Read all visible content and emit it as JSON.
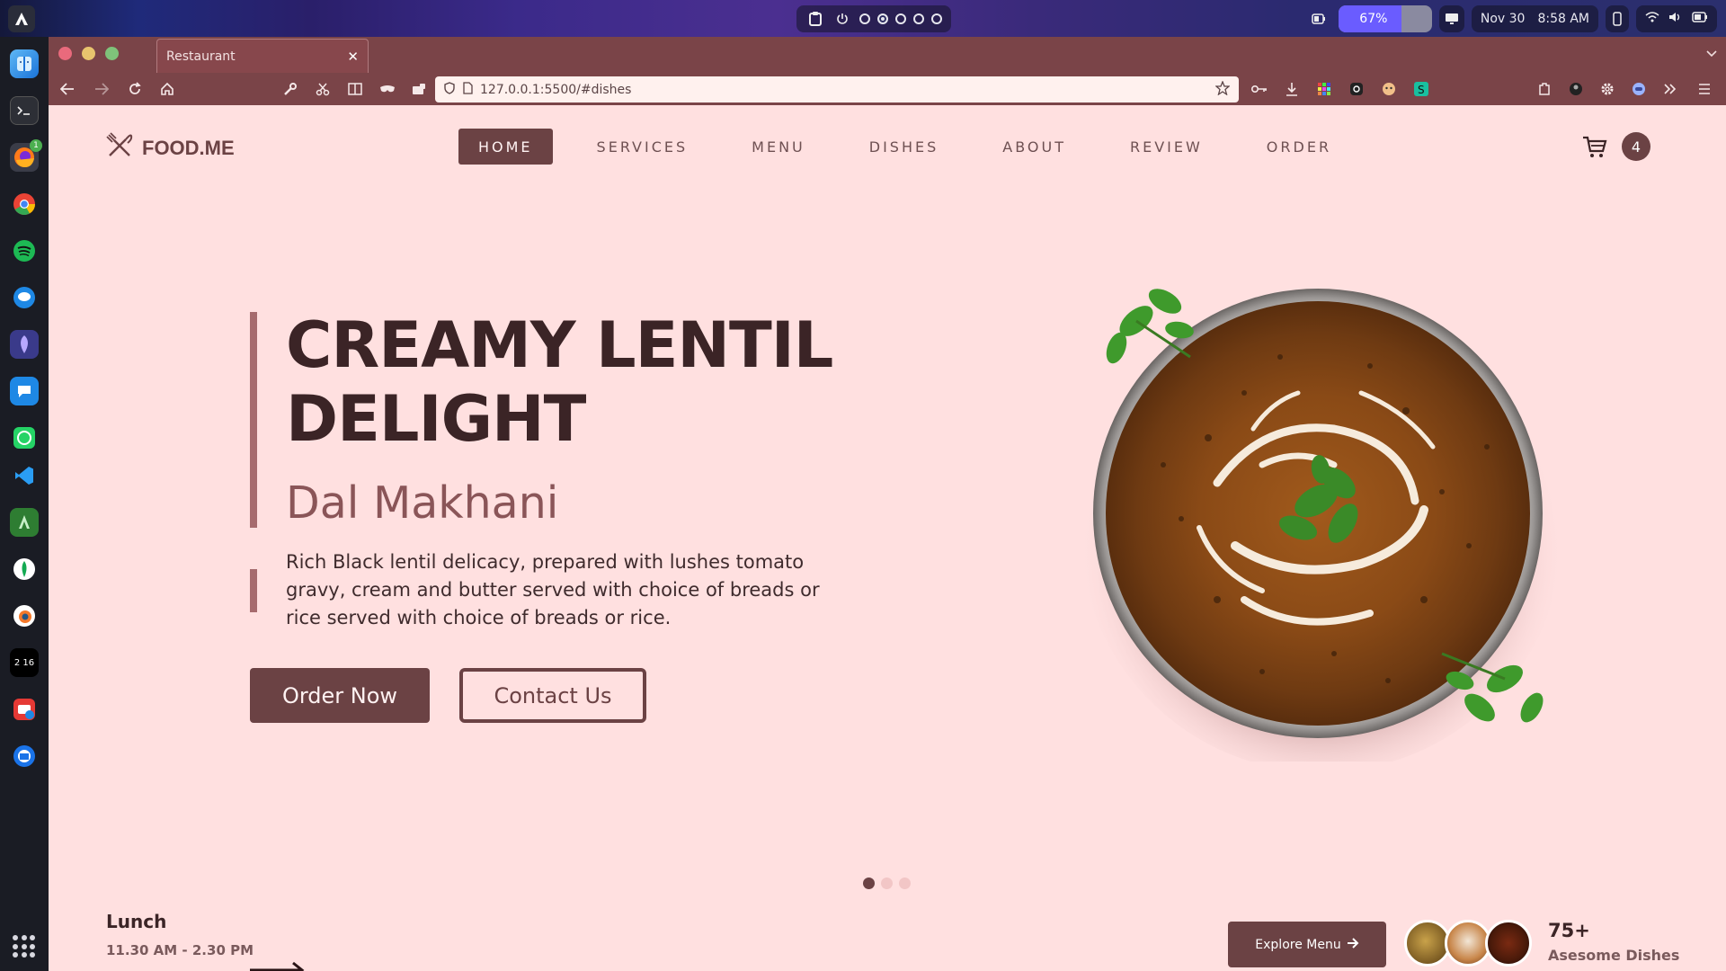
{
  "system": {
    "battery_percent": "67%",
    "battery_level": 0.67,
    "date": "Nov 30",
    "time": "8:58 AM"
  },
  "dock": {
    "badge_count": "1",
    "clock_text": "2 16",
    "items": [
      "finder-icon",
      "terminal-icon",
      "firefox-icon",
      "chrome-icon",
      "spotify-icon",
      "messages-icon",
      "notes-icon",
      "chat-icon",
      "whatsapp-icon",
      "vscode-icon",
      "android-studio-icon",
      "mongodb-icon",
      "blender-icon",
      "clock-icon",
      "downloader-icon",
      "thunderbird-icon"
    ]
  },
  "browser": {
    "tab_title": "Restaurant",
    "url": "127.0.0.1:5500/#dishes"
  },
  "site": {
    "logo_text": "FOOD.ME",
    "nav": [
      {
        "label": "HOME",
        "active": true
      },
      {
        "label": "SERVICES",
        "active": false
      },
      {
        "label": "MENU",
        "active": false
      },
      {
        "label": "DISHES",
        "active": false
      },
      {
        "label": "ABOUT",
        "active": false
      },
      {
        "label": "REVIEW",
        "active": false
      },
      {
        "label": "ORDER",
        "active": false
      }
    ],
    "cart_count": "4"
  },
  "hero": {
    "title_line1": "CREAMY LENTIL",
    "title_line2": "DELIGHT",
    "subtitle": "Dal Makhani",
    "description": "Rich Black lentil delicacy, prepared with lushes tomato gravy, cream and butter served with choice of breads or rice served with choice of breads or rice.",
    "order_button": "Order Now",
    "contact_button": "Contact Us",
    "slide_count": 3,
    "active_slide": 1
  },
  "footer_info": {
    "meal_title": "Lunch",
    "meal_time": "11.30 AM - 2.30 PM",
    "explore_button": "Explore Menu",
    "dish_count": "75+",
    "dish_label": "Asesome Dishes"
  },
  "colors": {
    "brand": "#6b4244",
    "page_bg": "#ffe0e0",
    "browser_chrome": "#7a4448",
    "accent_bar": "#a66b6e"
  }
}
